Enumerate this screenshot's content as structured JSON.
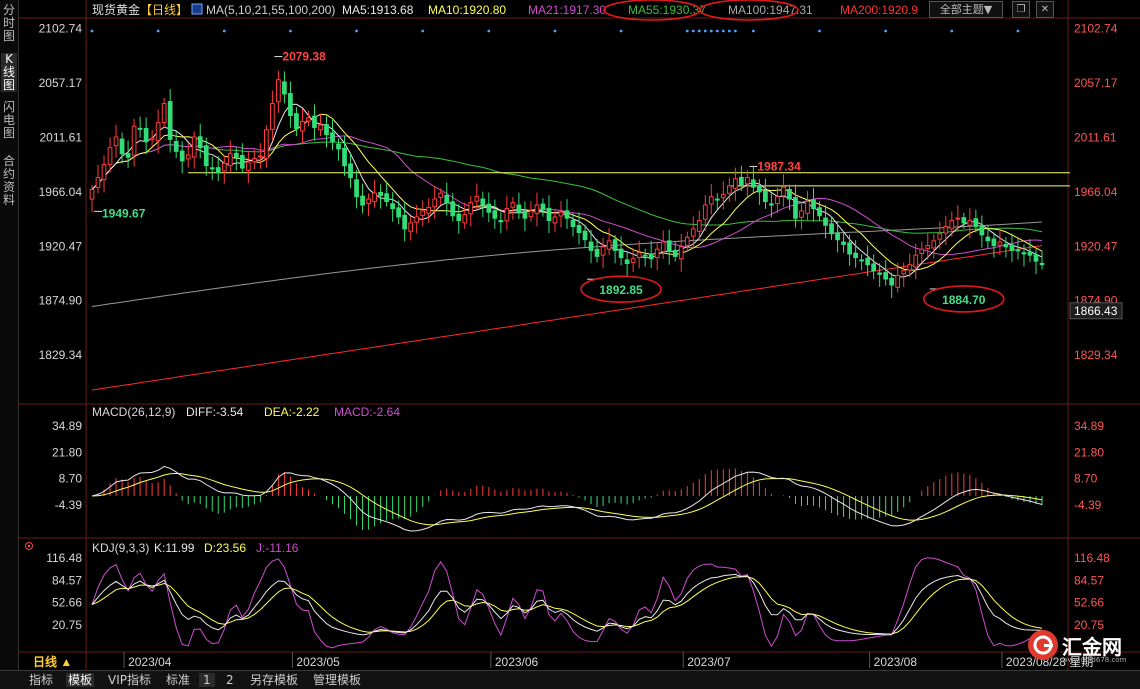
{
  "sidebar": {
    "tabs": [
      {
        "label": "分时图"
      },
      {
        "label": "K线图",
        "active": true
      },
      {
        "label": "闪电图"
      },
      {
        "label": "合约资料"
      }
    ]
  },
  "toolbar": {
    "theme_label": "全部主题▼",
    "restore_icon": "restore-icon",
    "close_icon": "close-icon"
  },
  "bottom_tabs": [
    {
      "label": "指标"
    },
    {
      "label": "模板",
      "active": true
    },
    {
      "label": "VIP指标"
    },
    {
      "label": "标准"
    },
    {
      "label": "1"
    },
    {
      "label": "2"
    },
    {
      "label": "另存模板"
    },
    {
      "label": "管理模板"
    }
  ],
  "period_label": "日线 ▲",
  "date_labels": [
    "2023/04",
    "2023/05",
    "2023/06",
    "2023/07",
    "2023/08",
    "2023/08/28 星期"
  ],
  "watermark": {
    "name": "汇金网",
    "url": "www.gold678.com"
  },
  "chart_data": [
    {
      "type": "candlestick",
      "title": "现货黄金",
      "period": "【日线】",
      "ma_legend": [
        {
          "label": "MA(5,10,21,55,100,200)",
          "color": "#cfcfcf"
        },
        {
          "label": "MA5:1913.68",
          "color": "#e8e8e8"
        },
        {
          "label": "MA10:1920.80",
          "color": "#ffff55"
        },
        {
          "label": "MA21:1917.30",
          "color": "#d04cd0"
        },
        {
          "label": "MA55:1930.37",
          "color": "#3cbf3c"
        },
        {
          "label": "MA100:1947.31",
          "color": "#aaaaaa"
        },
        {
          "label": "MA200:1920.9",
          "color": "#ff3333"
        }
      ],
      "y_ticks": [
        "2102.74",
        "2057.17",
        "2011.61",
        "1966.04",
        "1920.47",
        "1874.90",
        "1829.34"
      ],
      "current_price": "1866.43",
      "ylim": [
        1790,
        2110
      ],
      "annotations": [
        {
          "text": "2079.38",
          "price": 2079.38,
          "color": "#ff4444",
          "circled": false
        },
        {
          "text": "1949.67",
          "price": 1949.67,
          "color": "#44dd88",
          "circled": false
        },
        {
          "text": "1987.34",
          "price": 1987.34,
          "color": "#ff4444",
          "circled": false
        },
        {
          "text": "1892.85",
          "price": 1892.85,
          "color": "#44dd88",
          "circled": true
        },
        {
          "text": "1884.70",
          "price": 1884.7,
          "color": "#44dd88",
          "circled": true
        }
      ],
      "resistance_lines": [
        1982,
        1971
      ],
      "colors": {
        "up": "#ff3b3b",
        "down": "#33dd77",
        "grid": "#6b1a1a"
      },
      "closes": [
        1968,
        1978,
        1989,
        2003,
        2012,
        1998,
        1995,
        2021,
        2019,
        2008,
        2011,
        2024,
        2040,
        2010,
        2000,
        1992,
        1997,
        2012,
        2003,
        1988,
        1986,
        1982,
        1990,
        1998,
        1995,
        1986,
        1991,
        1994,
        1996,
        2018,
        2040,
        2060,
        2048,
        2030,
        2019,
        2025,
        2028,
        2020,
        2022,
        2014,
        2008,
        2002,
        1988,
        1978,
        1962,
        1955,
        1960,
        1965,
        1963,
        1958,
        1952,
        1945,
        1935,
        1940,
        1945,
        1950,
        1953,
        1960,
        1965,
        1957,
        1946,
        1942,
        1947,
        1957,
        1962,
        1955,
        1949,
        1944,
        1941,
        1952,
        1957,
        1949,
        1944,
        1950,
        1955,
        1951,
        1942,
        1945,
        1949,
        1944,
        1937,
        1932,
        1926,
        1917,
        1912,
        1920,
        1925,
        1917,
        1911,
        1906,
        1910,
        1915,
        1913,
        1910,
        1918,
        1924,
        1916,
        1912,
        1920,
        1928,
        1935,
        1942,
        1955,
        1962,
        1960,
        1964,
        1971,
        1977,
        1972,
        1978,
        1970,
        1966,
        1958,
        1955,
        1962,
        1970,
        1960,
        1944,
        1950,
        1958,
        1952,
        1946,
        1938,
        1931,
        1926,
        1922,
        1914,
        1911,
        1909,
        1905,
        1900,
        1897,
        1893,
        1888,
        1896,
        1900,
        1905,
        1913,
        1918,
        1921,
        1925,
        1931,
        1937,
        1942,
        1944,
        1940,
        1942,
        1937,
        1930,
        1925,
        1921,
        1924,
        1920,
        1917,
        1917,
        1914,
        1913,
        1908,
        1905
      ]
    },
    {
      "type": "macd",
      "title": "MACD(26,12,9)",
      "legend": [
        {
          "label": "DIFF:-3.54",
          "color": "#e8e8e8"
        },
        {
          "label": "DEA:-2.22",
          "color": "#ffff55"
        },
        {
          "label": "MACD:-2.64",
          "color": "#d04cd0"
        }
      ],
      "y_ticks": [
        "34.89",
        "21.80",
        "8.70",
        "-4.39"
      ],
      "ylim": [
        -20,
        40
      ]
    },
    {
      "type": "kdj",
      "title": "KDJ(9,3,3)",
      "legend": [
        {
          "label": "K:11.99",
          "color": "#e8e8e8"
        },
        {
          "label": "D:23.56",
          "color": "#ffff55"
        },
        {
          "label": "J:-11.16",
          "color": "#d04cd0"
        }
      ],
      "y_ticks": [
        "116.48",
        "84.57",
        "52.66",
        "20.75"
      ],
      "ylim": [
        -15,
        125
      ]
    }
  ]
}
